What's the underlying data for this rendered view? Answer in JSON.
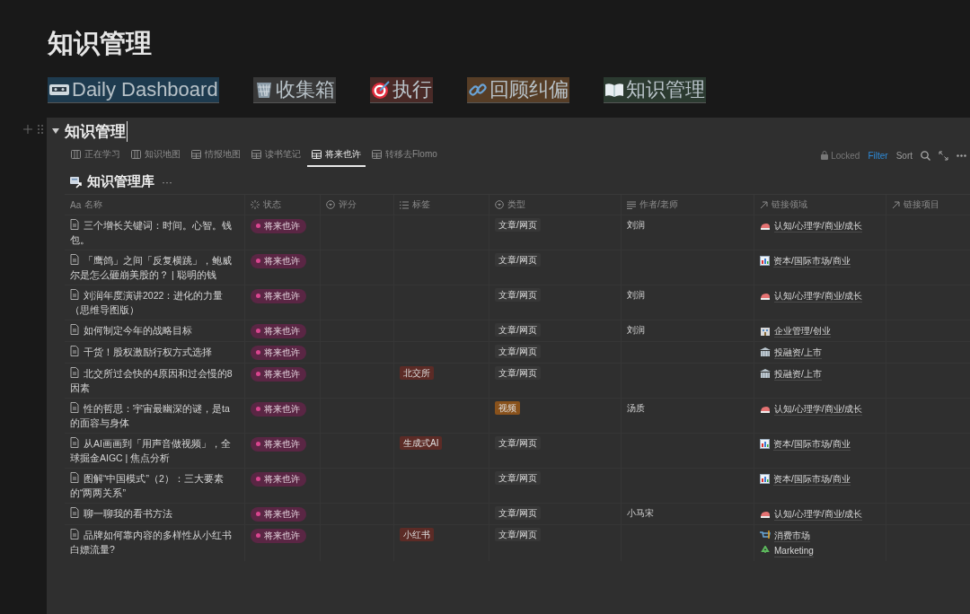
{
  "page_title": "知识管理",
  "links": [
    {
      "label": "Daily Dashboard",
      "kind": "tape",
      "color": "#1e3b4f"
    },
    {
      "label": "收集箱",
      "kind": "basket",
      "color": "#383838"
    },
    {
      "label": "执行",
      "kind": "target",
      "color": "#4a2a27"
    },
    {
      "label": "回顾纠偏",
      "kind": "link",
      "color": "#563d26"
    },
    {
      "label": "知识管理",
      "kind": "book",
      "color": "#2b3a30"
    }
  ],
  "section": {
    "title": "知识管理",
    "expanded": true
  },
  "views": [
    {
      "label": "正在学习",
      "kind": "board",
      "selected": false
    },
    {
      "label": "知识地图",
      "kind": "board",
      "selected": false
    },
    {
      "label": "情报地图",
      "kind": "table",
      "selected": false
    },
    {
      "label": "读书笔记",
      "kind": "table",
      "selected": false
    },
    {
      "label": "将来也许",
      "kind": "table",
      "selected": true
    },
    {
      "label": "转移去Flomo",
      "kind": "table",
      "selected": false
    }
  ],
  "toolbar": {
    "locked": "Locked",
    "filter": "Filter",
    "sort": "Sort"
  },
  "database": {
    "title": "知识管理库",
    "more": "···"
  },
  "columns": [
    {
      "label": "名称",
      "kind": "title",
      "prefix": "Aa"
    },
    {
      "label": "状态",
      "kind": "status"
    },
    {
      "label": "评分",
      "kind": "select"
    },
    {
      "label": "标签",
      "kind": "multi"
    },
    {
      "label": "类型",
      "kind": "select"
    },
    {
      "label": "作者/老师",
      "kind": "text"
    },
    {
      "label": "链接领域",
      "kind": "relation"
    },
    {
      "label": "链接项目",
      "kind": "relation"
    }
  ],
  "rows": [
    {
      "name": "三个增长关键词：时间。心智。钱包。",
      "status": "将来也许",
      "tags": [],
      "type": {
        "label": "文章/网页",
        "color": "#373737"
      },
      "author": "刘润",
      "domains": [
        {
          "label": "认知/心理学/商业/成长",
          "kind": "brain"
        }
      ]
    },
    {
      "name": "「鹰鸽」之间「反复横跳」，鲍威尔是怎么砸崩美股的？ | 聪明的钱",
      "status": "将来也许",
      "tags": [],
      "type": {
        "label": "文章/网页",
        "color": "#373737"
      },
      "author": "",
      "domains": [
        {
          "label": "资本/国际市场/商业",
          "kind": "chart"
        }
      ]
    },
    {
      "name": "刘润年度演讲2022：进化的力量（思维导图版）",
      "status": "将来也许",
      "tags": [],
      "type": {
        "label": "文章/网页",
        "color": "#373737"
      },
      "author": "刘润",
      "domains": [
        {
          "label": "认知/心理学/商业/成长",
          "kind": "brain"
        }
      ]
    },
    {
      "name": "如何制定今年的战略目标",
      "status": "将来也许",
      "tags": [],
      "type": {
        "label": "文章/网页",
        "color": "#373737"
      },
      "author": "刘润",
      "domains": [
        {
          "label": "企业管理/创业",
          "kind": "office"
        }
      ]
    },
    {
      "name": "干货！股权激励行权方式选择",
      "status": "将来也许",
      "tags": [],
      "type": {
        "label": "文章/网页",
        "color": "#373737"
      },
      "author": "",
      "domains": [
        {
          "label": "投融资/上市",
          "kind": "bank"
        }
      ]
    },
    {
      "name": "北交所过会快的4原因和过会慢的8因素",
      "status": "将来也许",
      "tags": [
        {
          "label": "北交所",
          "color": "#5c2b26"
        }
      ],
      "type": {
        "label": "文章/网页",
        "color": "#373737"
      },
      "author": "",
      "domains": [
        {
          "label": "投融资/上市",
          "kind": "bank"
        }
      ]
    },
    {
      "name": "性的哲思：宇宙最幽深的谜，是ta的面容与身体",
      "status": "将来也许",
      "tags": [],
      "type": {
        "label": "视频",
        "color": "#89521c"
      },
      "author": "汤质",
      "domains": [
        {
          "label": "认知/心理学/商业/成长",
          "kind": "brain"
        }
      ]
    },
    {
      "name": "从AI画画到「用声音做视频」，全球掘金AIGC | 焦点分析",
      "status": "将来也许",
      "tags": [
        {
          "label": "生成式AI",
          "color": "#5c2b26"
        }
      ],
      "type": {
        "label": "文章/网页",
        "color": "#373737"
      },
      "author": "",
      "domains": [
        {
          "label": "资本/国际市场/商业",
          "kind": "chart"
        }
      ]
    },
    {
      "name": "图解“中国模式”（2）：三大要素的“两两关系”",
      "status": "将来也许",
      "tags": [],
      "type": {
        "label": "文章/网页",
        "color": "#373737"
      },
      "author": "",
      "domains": [
        {
          "label": "资本/国际市场/商业",
          "kind": "chart"
        }
      ]
    },
    {
      "name": "聊一聊我的看书方法",
      "status": "将来也许",
      "tags": [],
      "type": {
        "label": "文章/网页",
        "color": "#373737"
      },
      "author": "小马宋",
      "domains": [
        {
          "label": "认知/心理学/商业/成长",
          "kind": "brain"
        }
      ]
    },
    {
      "name": "品牌如何靠内容的多样性从小红书白嫖流量?",
      "status": "将来也许",
      "tags": [
        {
          "label": "小红书",
          "color": "#5c2b26"
        }
      ],
      "type": {
        "label": "文章/网页",
        "color": "#373737"
      },
      "author": "",
      "domains": [
        {
          "label": "消费市场",
          "kind": "cart"
        },
        {
          "label": "Marketing",
          "kind": "recycle"
        }
      ]
    }
  ]
}
